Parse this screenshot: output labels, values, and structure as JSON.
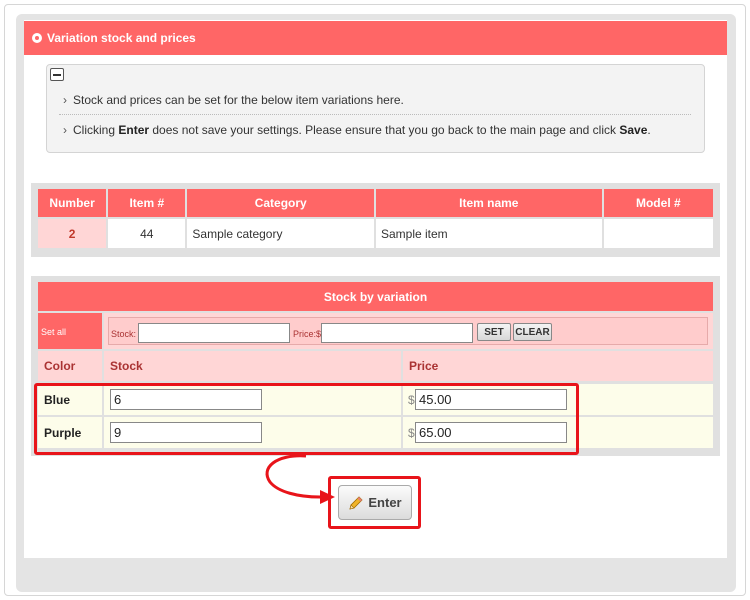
{
  "section": {
    "title": "Variation stock and prices"
  },
  "notes": {
    "line1": "Stock and prices can be set for the below item variations here.",
    "line2_prefix": "Clicking ",
    "line2_enter": "Enter",
    "line2_middle": " does not save your settings. Please ensure that you go back to the main page and click ",
    "line2_save": "Save",
    "line2_suffix": "."
  },
  "info_table": {
    "headers": [
      "Number",
      "Item #",
      "Category",
      "Item name",
      "Model #"
    ],
    "row": [
      "2",
      "44",
      "Sample category",
      "Sample item",
      ""
    ]
  },
  "stock": {
    "title": "Stock by variation",
    "set_all_label": "Set all",
    "stock_label": "Stock:",
    "price_label": "Price:$",
    "set_button": "SET",
    "clear_button": "CLEAR",
    "columns": [
      "Color",
      "Stock",
      "Price"
    ],
    "currency": "$",
    "rows": [
      {
        "color": "Blue",
        "stock": "6",
        "price": "45.00"
      },
      {
        "color": "Purple",
        "stock": "9",
        "price": "65.00"
      }
    ]
  },
  "enter_button": "Enter",
  "colors": {
    "accent": "#ff6666",
    "light_accent": "#ffd6d6",
    "highlight": "#e8141a",
    "row_bg": "#fdfdea"
  }
}
